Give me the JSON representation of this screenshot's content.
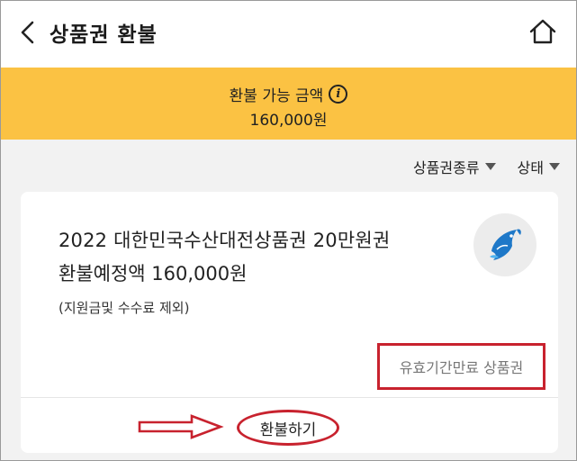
{
  "header": {
    "title": "상품권 환불",
    "back_icon": "chevron-left-icon",
    "home_icon": "home-icon"
  },
  "banner": {
    "label": "환불 가능 금액",
    "info_icon_glyph": "i",
    "amount": "160,000원",
    "color": "#fbc243"
  },
  "filters": [
    {
      "label": "상품권종류"
    },
    {
      "label": "상태"
    }
  ],
  "card": {
    "title": "2022 대한민국수산대전상품권 20만원권",
    "refund_amount": "환불예정액 160,000원",
    "note": "(지원금및 수수료 제외)",
    "status": "유효기간만료 상품권",
    "action": "환불하기",
    "logo_icon": "fish-logo-icon"
  },
  "annotation_color": "#c8222e"
}
